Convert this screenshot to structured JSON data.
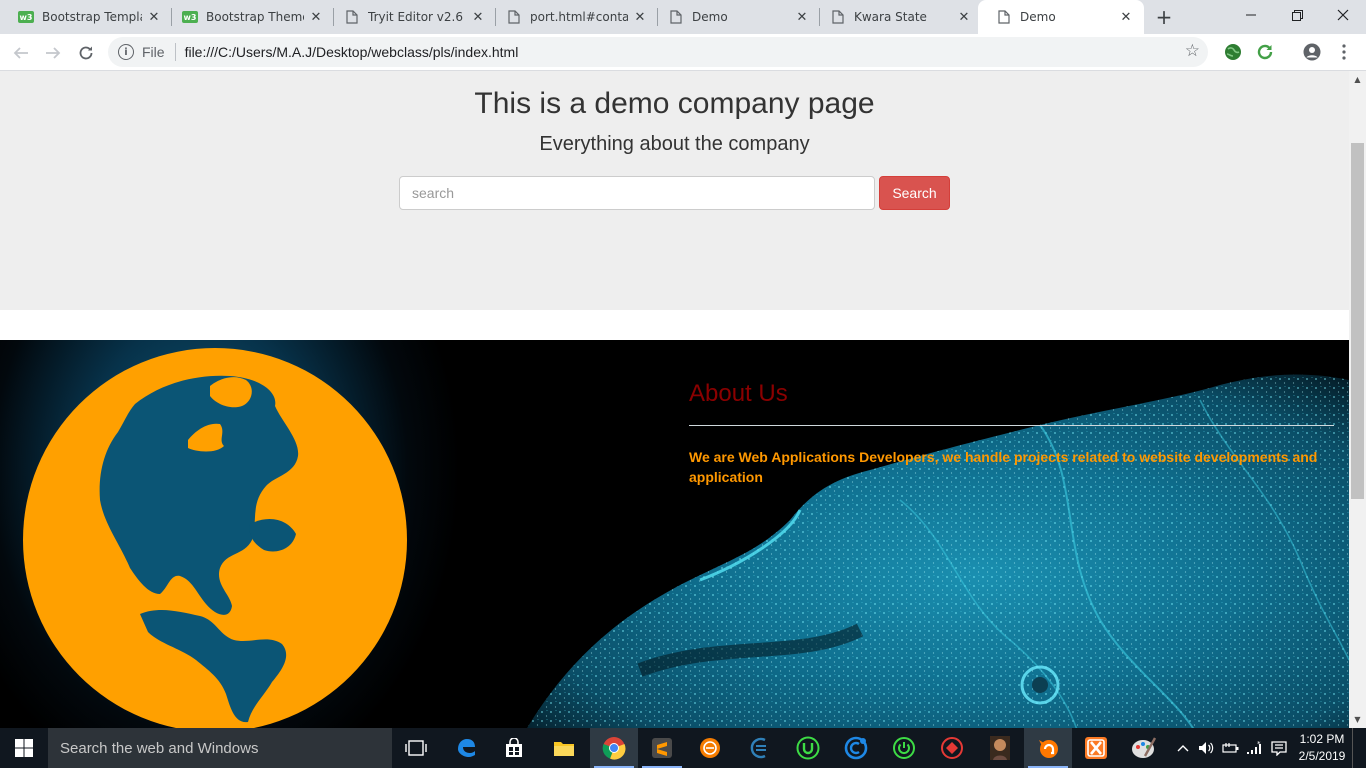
{
  "browser": {
    "tabs": [
      {
        "title": "Bootstrap Templat",
        "icon": "w3schools-icon",
        "active": false
      },
      {
        "title": "Bootstrap Theme",
        "icon": "w3schools-icon",
        "active": false
      },
      {
        "title": "Tryit Editor v2.6",
        "icon": "page-icon",
        "active": false
      },
      {
        "title": "port.html#contact",
        "icon": "page-icon",
        "active": false
      },
      {
        "title": "Demo",
        "icon": "page-icon",
        "active": false
      },
      {
        "title": "Kwara State",
        "icon": "page-icon",
        "active": false
      },
      {
        "title": "Demo",
        "icon": "page-icon",
        "active": true
      }
    ],
    "new_tab_label": "+",
    "omnibox": {
      "scheme_label": "File",
      "url": "file:///C:/Users/M.A.J/Desktop/webclass/pls/index.html"
    }
  },
  "page": {
    "jumbotron": {
      "title": "This is a demo company page",
      "subtitle": "Everything about the company",
      "search_placeholder": "search",
      "search_button": "Search"
    },
    "about": {
      "title": "About Us",
      "text": "We are Web Applications Developers, we handle projects related to website developments and application"
    }
  },
  "taskbar": {
    "search_placeholder": "Search the web and Windows",
    "clock_time": "1:02 PM",
    "clock_date": "2/5/2019"
  },
  "colors": {
    "jumbotron_bg": "#eeeeee",
    "search_button": "#d9534f",
    "about_title": "#8b0000",
    "about_text": "#ff9800",
    "globe": "#ffa000"
  }
}
